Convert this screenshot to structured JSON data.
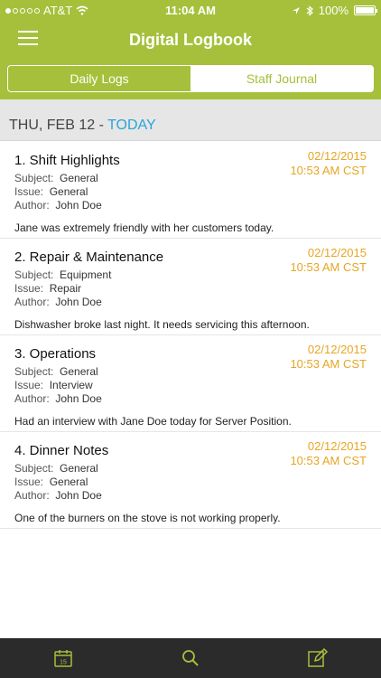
{
  "status_bar": {
    "carrier": "AT&T",
    "time": "11:04 AM",
    "battery": "100%"
  },
  "nav": {
    "title": "Digital Logbook"
  },
  "tabs": {
    "daily_logs": "Daily Logs",
    "staff_journal": "Staff Journal"
  },
  "date_header": {
    "date": "THU, FEB 12 - ",
    "today": "TODAY"
  },
  "labels": {
    "subject": "Subject:",
    "issue": "Issue:",
    "author": "Author:"
  },
  "entries": [
    {
      "title": "1. Shift Highlights",
      "subject": "General",
      "issue": "General",
      "author": "John Doe",
      "note": "Jane was extremely friendly with her customers today.",
      "date": "02/12/2015",
      "time": "10:53 AM CST"
    },
    {
      "title": "2. Repair & Maintenance",
      "subject": "Equipment",
      "issue": "Repair",
      "author": "John Doe",
      "note": "Dishwasher broke last night.  It needs servicing this afternoon.",
      "date": "02/12/2015",
      "time": "10:53 AM CST"
    },
    {
      "title": "3. Operations",
      "subject": "General",
      "issue": "Interview",
      "author": "John Doe",
      "note": "Had an interview with Jane Doe today for Server Position.",
      "date": "02/12/2015",
      "time": "10:53 AM CST"
    },
    {
      "title": "4. Dinner Notes",
      "subject": "General",
      "issue": "General",
      "author": "John Doe",
      "note": "One of the burners on the stove is not working properly.",
      "date": "02/12/2015",
      "time": "10:53 AM CST"
    }
  ],
  "tab_bar": {
    "calendar_day": "15",
    "icons": [
      "calendar-icon",
      "search-icon",
      "compose-icon"
    ]
  },
  "colors": {
    "brand": "#a6c03b",
    "accent_date": "#e6a624",
    "today": "#2aa5d6",
    "tab_bar": "#2b2b2b"
  }
}
